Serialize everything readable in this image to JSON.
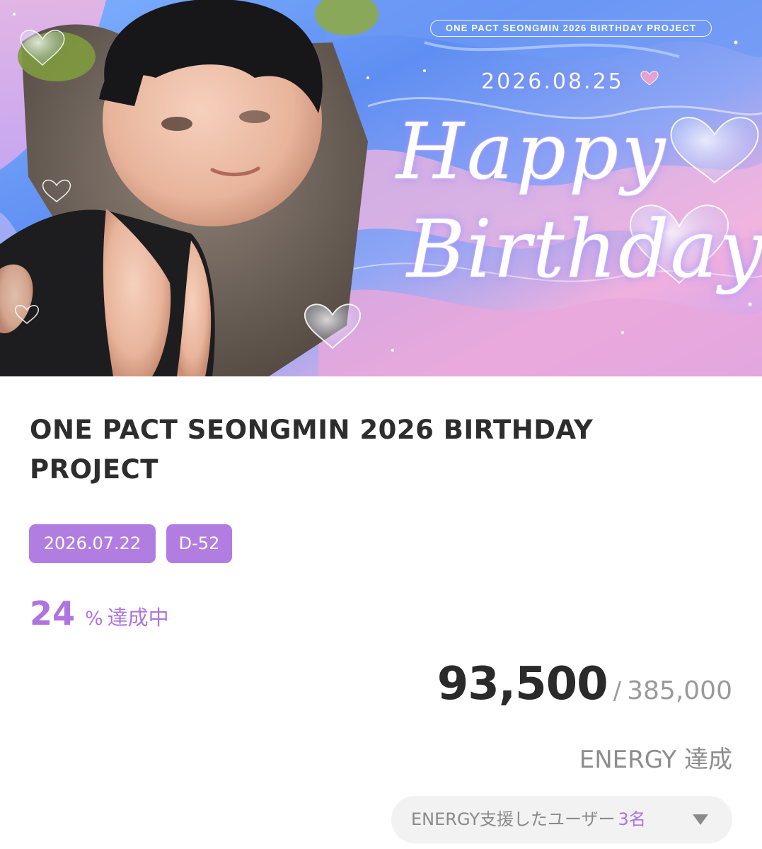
{
  "banner": {
    "project_pill": "ONE PACT SEONGMIN 2026 BIRTHDAY PROJECT",
    "event_date": "2026.08.25",
    "script_line1": "Happy",
    "script_line2": "Birthday",
    "photo_subject": "portrait-photo"
  },
  "project": {
    "title": "ONE PACT SEONGMIN 2026 BIRTHDAY PROJECT",
    "deadline": "2026.07.22",
    "dday": "D-52"
  },
  "progress": {
    "percent": "24",
    "percent_unit": "%",
    "status_text": "達成中"
  },
  "energy": {
    "current": "93,500",
    "separator": "/",
    "goal": "385,000",
    "label": "ENERGY 達成"
  },
  "supporters": {
    "label": "ENERGY支援したユーザー",
    "count": "3名",
    "icon": "chevron-down-icon"
  },
  "colors": {
    "accent": "#b27de0",
    "accent_text": "#ae74df",
    "title_text": "#2d2d2d",
    "muted_text": "#8d8d8d",
    "pill_bg": "#f2f2f3"
  }
}
